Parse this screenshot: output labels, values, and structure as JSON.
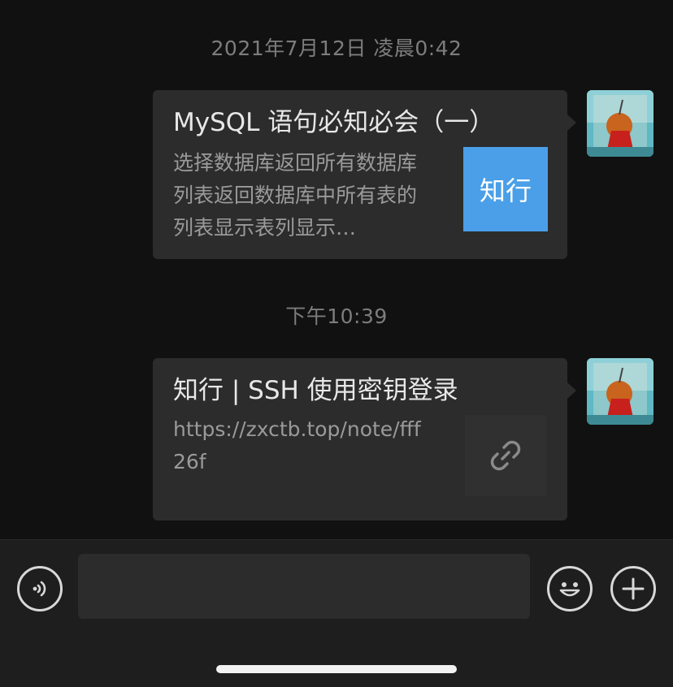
{
  "messages": [
    {
      "timestamp": "2021年7月12日 凌晨0:42",
      "card": {
        "title": "MySQL 语句必知必会（一）",
        "description": "选择数据库返回所有数据库列表返回数据库中所有表的列表显示表列显示…",
        "thumbnail_text": "知行",
        "thumbnail_color": "#4a9fe8"
      }
    },
    {
      "timestamp": "下午10:39",
      "card": {
        "title": "知行 | SSH 使用密钥登录",
        "url": "https://zxctb.top/note/fff26f",
        "thumbnail_icon": "link-icon"
      }
    }
  ],
  "input_bar": {
    "left_icon": "voice-icon",
    "input_value": "",
    "right_icons": [
      "emoji-icon",
      "plus-icon"
    ]
  },
  "colors": {
    "background": "#111111",
    "bubble": "#2c2c2c",
    "input_bar": "#1e1e1e",
    "accent": "#4a9fe8"
  }
}
